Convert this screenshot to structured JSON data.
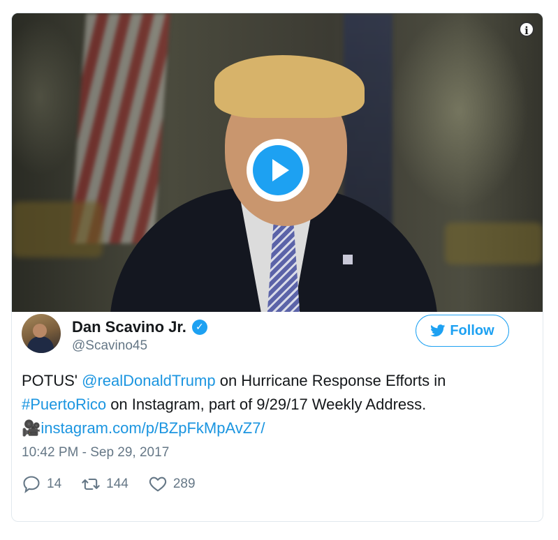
{
  "media": {
    "info_icon": "info-icon",
    "play_icon": "play-icon"
  },
  "author": {
    "name": "Dan Scavino Jr.",
    "handle": "@Scavino45",
    "verified_icon": "verified-badge-icon"
  },
  "follow": {
    "label": "Follow",
    "icon": "twitter-bird-icon"
  },
  "tweet": {
    "text_before_mention": "POTUS' ",
    "mention": "@realDonaldTrump",
    "text_after_mention": " on Hurricane Response Efforts in ",
    "hashtag": "#PuertoRico",
    "text_after_hashtag": " on Instagram, part of 9/29/17 Weekly Address.",
    "emoji": "🎥",
    "link": "instagram.com/p/BZpFkMpAvZ7/"
  },
  "timestamp": "10:42 PM - Sep 29, 2017",
  "actions": {
    "replies": "14",
    "retweets": "144",
    "likes": "289"
  },
  "colors": {
    "accent": "#1da1f2",
    "link": "#1b95e0",
    "muted": "#657786",
    "text": "#14171a",
    "border": "#e1e8ed"
  }
}
